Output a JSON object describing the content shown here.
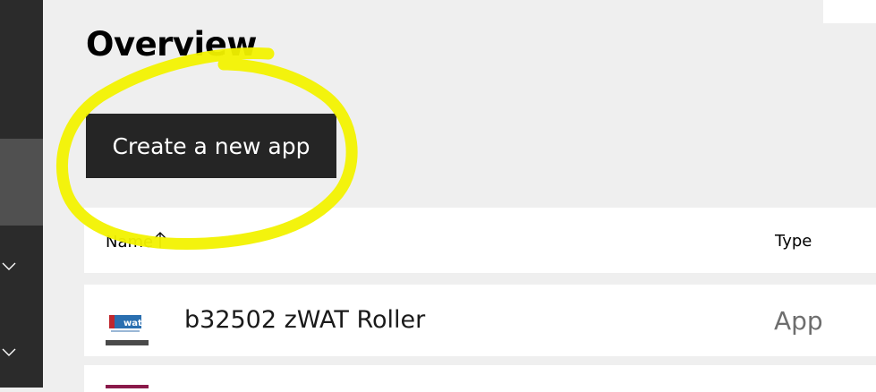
{
  "page": {
    "title": "Overview",
    "create_button_label": "Create a new app"
  },
  "table": {
    "columns": {
      "name": "Name",
      "type": "Type"
    },
    "rows": [
      {
        "name": "b32502 zWAT Roller",
        "type": "App",
        "icon": "wat-logo-icon"
      },
      {
        "name": "",
        "type": "",
        "icon": "app-icon"
      }
    ]
  },
  "sidebar": {
    "icons": [
      "chevron-down-icon",
      "chevron-down-icon"
    ]
  },
  "colors": {
    "sidebar": "#2b2b2b",
    "sidebar_active": "#505050",
    "primary_button": "#252525",
    "page_background": "#efefef",
    "highlight_annotation": "#f2f200"
  }
}
